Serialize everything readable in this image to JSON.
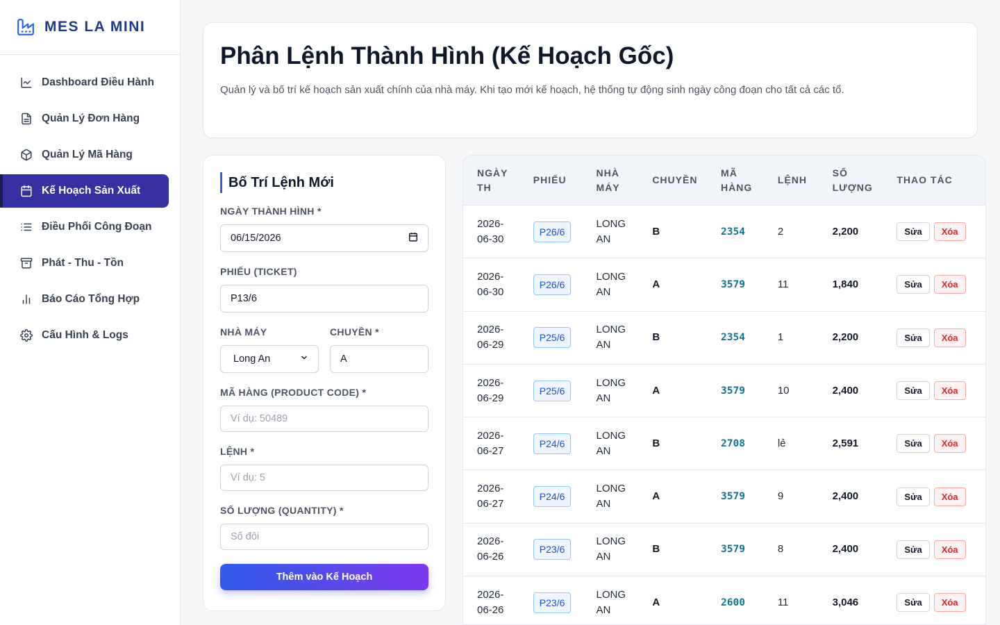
{
  "app": {
    "brand": "MES LA MINI"
  },
  "sidebar": {
    "items": [
      {
        "label": "Dashboard Điều Hành",
        "icon": "chart-line-icon",
        "active": false
      },
      {
        "label": "Quản Lý Đơn Hàng",
        "icon": "document-icon",
        "active": false
      },
      {
        "label": "Quản Lý Mã Hàng",
        "icon": "box-icon",
        "active": false
      },
      {
        "label": "Kế Hoạch Sản Xuất",
        "icon": "calendar-icon",
        "active": true
      },
      {
        "label": "Điều Phối Công Đoạn",
        "icon": "list-icon",
        "active": false
      },
      {
        "label": "Phát - Thu - Tồn",
        "icon": "archive-icon",
        "active": false
      },
      {
        "label": "Báo Cáo Tổng Hợp",
        "icon": "bar-chart-icon",
        "active": false
      },
      {
        "label": "Cấu Hình & Logs",
        "icon": "gear-icon",
        "active": false
      }
    ]
  },
  "header": {
    "title": "Phân Lệnh Thành Hình (Kế Hoạch Gốc)",
    "description": "Quản lý và bố trí kế hoạch sản xuất chính của nhà máy. Khi tạo mới kế hoạch, hệ thống tự động sinh ngày công đoạn cho tất cả các tổ."
  },
  "form": {
    "title": "Bố Trí Lệnh Mới",
    "date_label": "NGÀY THÀNH HÌNH *",
    "date_value": "06/15/2026",
    "ticket_label": "PHIẾU (TICKET)",
    "ticket_value": "P13/6",
    "factory_label": "NHÀ MÁY",
    "factory_value": "Long An",
    "line_label": "CHUYỀN *",
    "line_value": "A",
    "code_label": "MÃ HÀNG (PRODUCT CODE) *",
    "code_placeholder": "Ví dụ: 50489",
    "order_label": "LỆNH *",
    "order_placeholder": "Ví dụ: 5",
    "qty_label": "SỐ LƯỢNG (QUANTITY) *",
    "qty_placeholder": "Số đôi",
    "submit_label": "Thêm vào Kế Hoạch"
  },
  "table": {
    "headers": {
      "date_1": "NGÀY",
      "date_2": "TH",
      "ticket": "PHIẾU",
      "factory_1": "NHÀ",
      "factory_2": "MÁY",
      "line": "CHUYỀN",
      "code_1": "MÃ",
      "code_2": "HÀNG",
      "order": "LỆNH",
      "qty_1": "SỐ",
      "qty_2": "LƯỢNG",
      "actions": "THAO TÁC"
    },
    "edit_label": "Sửa",
    "delete_label": "Xóa",
    "rows": [
      {
        "date_1": "2026-",
        "date_2": "06-30",
        "ticket": "P26/6",
        "factory_1": "LONG",
        "factory_2": "AN",
        "line": "B",
        "code": "2354",
        "order": "2",
        "qty": "2,200"
      },
      {
        "date_1": "2026-",
        "date_2": "06-30",
        "ticket": "P26/6",
        "factory_1": "LONG",
        "factory_2": "AN",
        "line": "A",
        "code": "3579",
        "order": "11",
        "qty": "1,840"
      },
      {
        "date_1": "2026-",
        "date_2": "06-29",
        "ticket": "P25/6",
        "factory_1": "LONG",
        "factory_2": "AN",
        "line": "B",
        "code": "2354",
        "order": "1",
        "qty": "2,200"
      },
      {
        "date_1": "2026-",
        "date_2": "06-29",
        "ticket": "P25/6",
        "factory_1": "LONG",
        "factory_2": "AN",
        "line": "A",
        "code": "3579",
        "order": "10",
        "qty": "2,400"
      },
      {
        "date_1": "2026-",
        "date_2": "06-27",
        "ticket": "P24/6",
        "factory_1": "LONG",
        "factory_2": "AN",
        "line": "B",
        "code": "2708",
        "order": "lẻ",
        "qty": "2,591"
      },
      {
        "date_1": "2026-",
        "date_2": "06-27",
        "ticket": "P24/6",
        "factory_1": "LONG",
        "factory_2": "AN",
        "line": "A",
        "code": "3579",
        "order": "9",
        "qty": "2,400"
      },
      {
        "date_1": "2026-",
        "date_2": "06-26",
        "ticket": "P23/6",
        "factory_1": "LONG",
        "factory_2": "AN",
        "line": "B",
        "code": "3579",
        "order": "8",
        "qty": "2,400"
      },
      {
        "date_1": "2026-",
        "date_2": "06-26",
        "ticket": "P23/6",
        "factory_1": "LONG",
        "factory_2": "AN",
        "line": "A",
        "code": "2600",
        "order": "11",
        "qty": "3,046"
      }
    ]
  }
}
